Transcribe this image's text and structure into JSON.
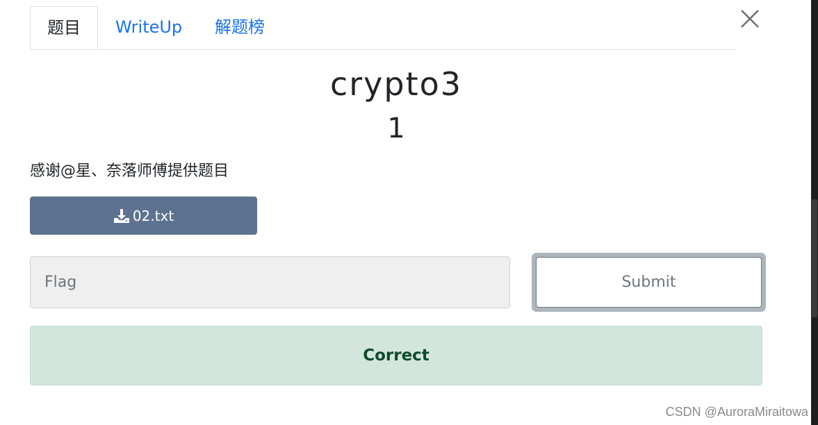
{
  "tabs": [
    {
      "label": "题目",
      "active": true
    },
    {
      "label": "WriteUp",
      "active": false
    },
    {
      "label": "解题榜",
      "active": false
    }
  ],
  "challenge": {
    "name": "crypto3",
    "points": "1",
    "description": "感谢@星、奈落师傅提供题目"
  },
  "download": {
    "icon": "download-icon",
    "label": "02.txt"
  },
  "flag_form": {
    "placeholder": "Flag",
    "value": "",
    "submit_label": "Submit"
  },
  "result": {
    "message": "Correct",
    "status_color": "#d3e6dd"
  },
  "watermark": "CSDN @AuroraMiraitowa",
  "colors": {
    "accent_link": "#1a73e8",
    "download_button": "#5d728e",
    "success_text": "#0e4a2c"
  }
}
